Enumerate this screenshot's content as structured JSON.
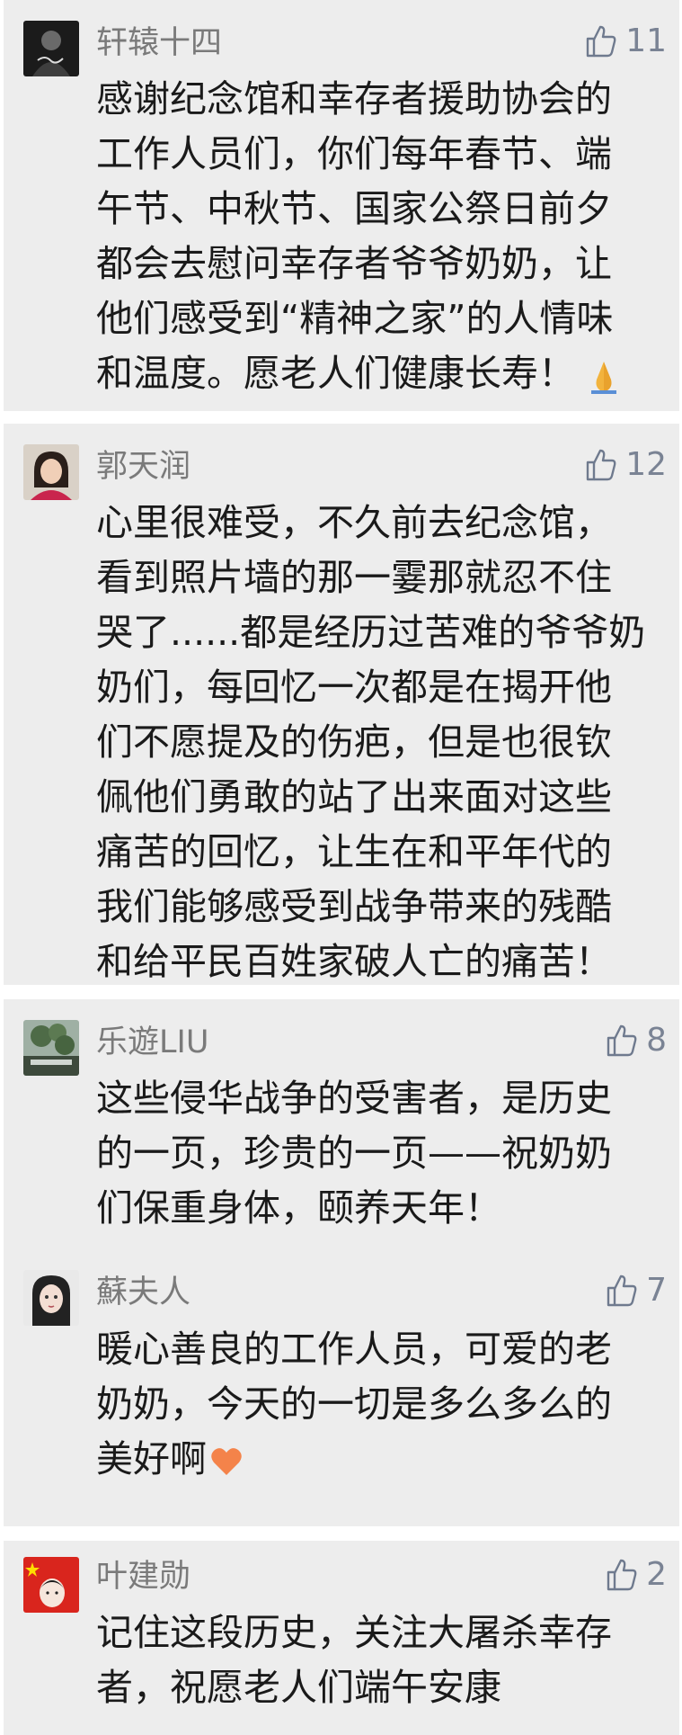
{
  "comments": [
    {
      "name": "轩辕十四",
      "likes": "11",
      "lines": [
        "感谢纪念馆和幸存者援助协会的",
        "工作人员们，你们每年春节、端",
        "午节、中秋节、国家公祭日前夕",
        "都会去慰问幸存者爷爷奶奶，让",
        "他们感受到“精神之家”的人情味",
        "和温度。愿老人们健康长寿！"
      ],
      "emoji": "folded-hands-emoji"
    },
    {
      "name": "郭天润",
      "likes": "12",
      "lines": [
        "心里很难受，不久前去纪念馆，",
        "看到照片墙的那一霎那就忍不住",
        "哭了......都是经历过苦难的爷爷奶",
        "奶们，每回忆一次都是在揭开他",
        "们不愿提及的伤疤，但是也很钦",
        "佩他们勇敢的站了出来面对这些",
        "痛苦的回忆，让生在和平年代的",
        "我们能够感受到战争带来的残酷",
        "和给平民百姓家破人亡的痛苦！"
      ]
    },
    {
      "name": "乐遊LIU",
      "likes": "8",
      "lines": [
        "这些侵华战争的受害者，是历史",
        "的一页，珍贵的一页——祝奶奶",
        "们保重身体，颐养天年！"
      ]
    },
    {
      "name": "蘇夫人",
      "likes": "7",
      "lines": [
        "暖心善良的工作人员，可爱的老",
        "奶奶，今天的一切是多么多么的",
        "美好啊"
      ],
      "emoji": "orange-heart-emoji"
    },
    {
      "name": "叶建勋",
      "likes": "2",
      "lines": [
        "记住这段历史，关注大屠杀幸存",
        "者，祝愿老人们端午安康"
      ]
    }
  ],
  "colors": {
    "card_background": "#ededed",
    "page_background": "#ffffff",
    "name_text": "#7a7a7a",
    "like_icon": "#6f7a8e",
    "body_text": "#1a1a1a",
    "heart": "#f4834a"
  }
}
